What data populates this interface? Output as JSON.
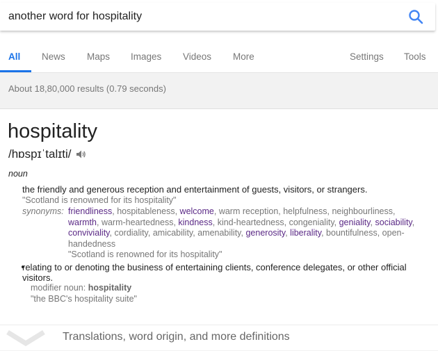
{
  "search": {
    "query": "another word for hospitality"
  },
  "tabs": [
    {
      "label": "All",
      "active": true
    },
    {
      "label": "News"
    },
    {
      "label": "Maps"
    },
    {
      "label": "Images"
    },
    {
      "label": "Videos"
    },
    {
      "label": "More"
    },
    {
      "label": "Settings"
    },
    {
      "label": "Tools"
    }
  ],
  "stats": "About 18,80,000 results (0.79 seconds)",
  "dictionary": {
    "word": "hospitality",
    "pronunciation": "/hɒspɪˈtalɪti/",
    "part_of_speech": "noun",
    "sense1": {
      "definition": "the friendly and generous reception and entertainment of guests, visitors, or strangers.",
      "example": "\"Scotland is renowned for its hospitality\"",
      "synonyms_label": "synonyms:",
      "synonyms": [
        {
          "text": "friendliness",
          "link": true
        },
        {
          "text": "hospitableness",
          "link": false
        },
        {
          "text": "welcome",
          "link": true
        },
        {
          "text": "warm reception",
          "link": false
        },
        {
          "text": "helpfulness",
          "link": false
        },
        {
          "text": "neighbourliness",
          "link": false
        },
        {
          "text": "warmth",
          "link": true
        },
        {
          "text": "warm-heartedness",
          "link": false
        },
        {
          "text": "kindness",
          "link": true
        },
        {
          "text": "kind-heartedness",
          "link": false
        },
        {
          "text": "congeniality",
          "link": false
        },
        {
          "text": "geniality",
          "link": true
        },
        {
          "text": "sociability",
          "link": true
        },
        {
          "text": "conviviality",
          "link": true
        },
        {
          "text": "cordiality",
          "link": false
        },
        {
          "text": "amicability",
          "link": false
        },
        {
          "text": "amenability",
          "link": false
        },
        {
          "text": "generosity",
          "link": true
        },
        {
          "text": "liberality",
          "link": true
        },
        {
          "text": "bountifulness",
          "link": false
        },
        {
          "text": "open-handedness",
          "link": false
        }
      ],
      "synonym_example": "\"Scotland is renowned for its hospitality\""
    },
    "sense2": {
      "definition_line1": "relating to or denoting the business of entertaining clients, conference delegates, or other official",
      "definition_line2": "visitors.",
      "modifier_label": "modifier noun:",
      "modifier_word": "hospitality",
      "example": "\"the BBC's hospitality suite\""
    },
    "more_label": "Translations, word origin, and more definitions"
  },
  "colors": {
    "accent": "#1a73e8",
    "synonym_link": "#5b2a86"
  }
}
